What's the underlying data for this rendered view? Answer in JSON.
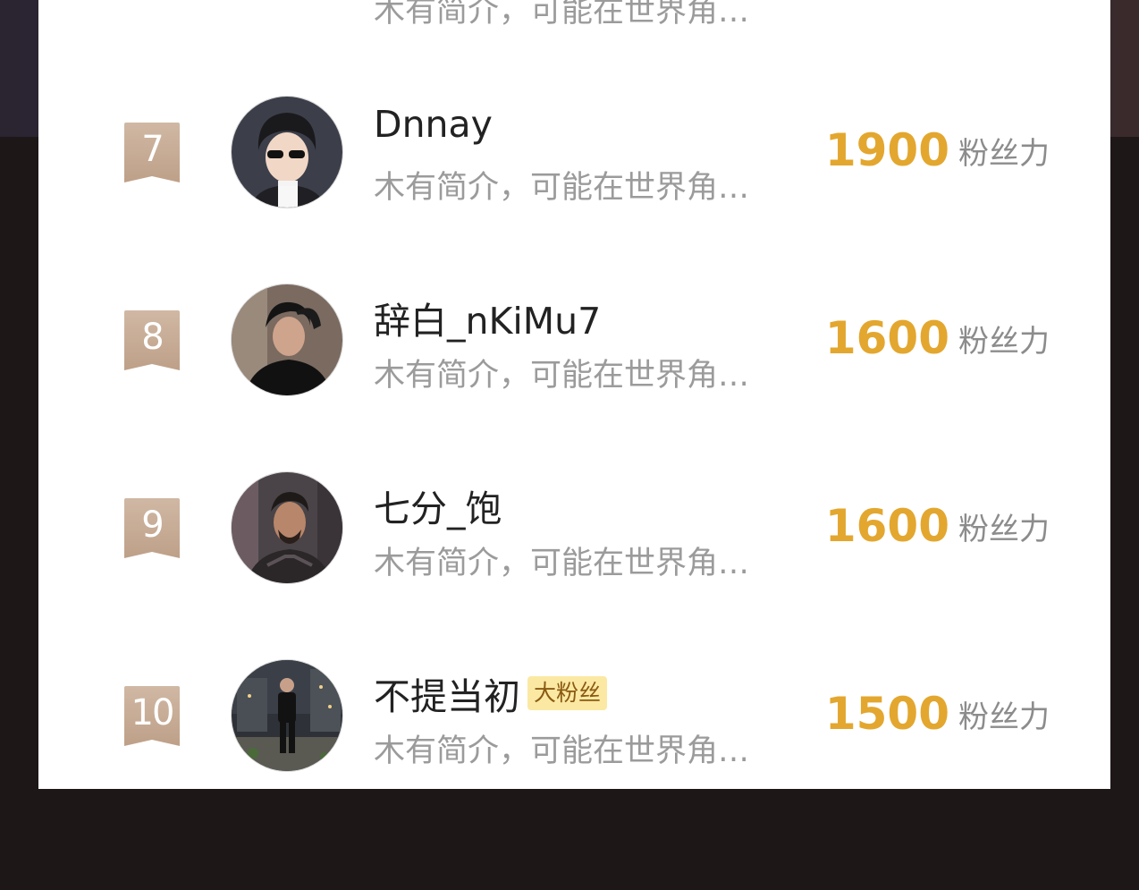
{
  "colors": {
    "score": "#e3a72f",
    "rank_badge": "#c7ab93",
    "big_fan_badge_bg": "#fbe9a3",
    "intro_text": "#9b9b9b"
  },
  "previous_row": {
    "intro": "木有简介，可能在世界角…"
  },
  "ranking": [
    {
      "rank": "7",
      "name": "Dnnay",
      "intro": "木有简介，可能在世界角…",
      "score": "1900",
      "score_unit": "粉丝力",
      "badge": ""
    },
    {
      "rank": "8",
      "name": "辞白_nKiMu7",
      "intro": "木有简介，可能在世界角…",
      "score": "1600",
      "score_unit": "粉丝力",
      "badge": ""
    },
    {
      "rank": "9",
      "name": "七分_饱",
      "intro": "木有简介，可能在世界角…",
      "score": "1600",
      "score_unit": "粉丝力",
      "badge": ""
    },
    {
      "rank": "10",
      "name": "不提当初",
      "intro": "木有简介，可能在世界角…",
      "score": "1500",
      "score_unit": "粉丝力",
      "badge": "大粉丝"
    }
  ]
}
